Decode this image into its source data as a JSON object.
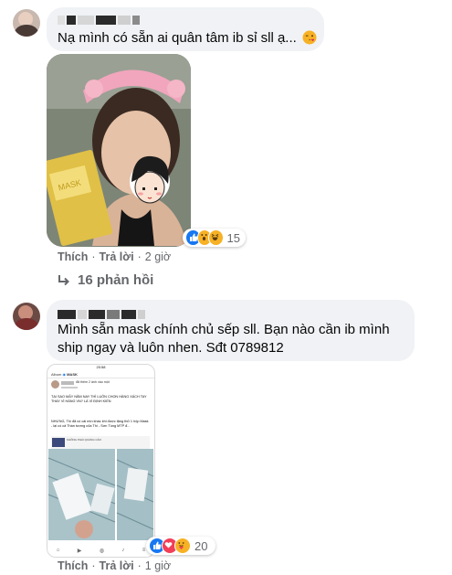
{
  "comments": [
    {
      "text": "Nạ mình có sẵn ai quân tâm ib sỉ sll ạ...",
      "emoji": "wink-kiss-emoji",
      "like_label": "Thích",
      "reply_label": "Trả lời",
      "time": "2 giờ",
      "reaction_count": "15",
      "replies_label": "16 phản hồi"
    },
    {
      "text": "Mình sẵn mask chính chủ sếp sll. Bạn nào cần ib mình\nship ngay và luôn nhen. Sđt 0789812",
      "like_label": "Thích",
      "reply_label": "Trả lời",
      "time": "1 giờ",
      "reaction_count": "20"
    }
  ],
  "shared_screenshot": {
    "status_time": "20:58",
    "album_label": "Album",
    "mask_label": "MASK",
    "post_header": "đã thêm 2 ảnh vào một",
    "post_line1": "TẠI SAO MẤY NĂM NAY THÌ LUÔN CHỌN HÀNG XÁCH TAY THAY VÌ HÀNG VN?  LÀ VÌ ĐỊNH KIẾN",
    "post_line2": "NHƯNG, Thì đã có cái mìn khác khi được tặng thử 1 hộp Mask - lại có cả Thần tượng của Thì - Sơn Tùng MTP đ...",
    "see_more": "Xem thêm",
    "badge_text": "KHÔNG PHẢI QUẢNG CÁO"
  },
  "colors": {
    "bubble_bg": "#f0f2f5",
    "meta_text": "#65676b",
    "like_blue": "#1877f2",
    "love_red": "#f33e58",
    "haha_yellow": "#f7b125"
  }
}
